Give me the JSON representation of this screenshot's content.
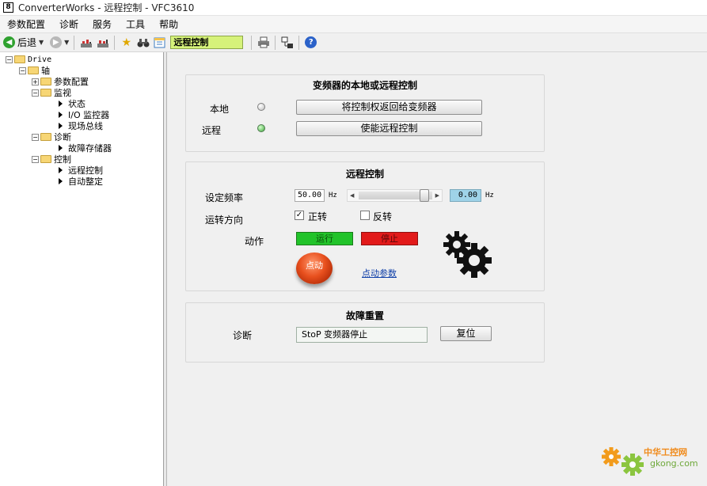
{
  "window": {
    "title": "ConverterWorks - 远程控制 - VFC3610",
    "app_icon": "8"
  },
  "menu": [
    "参数配置",
    "诊断",
    "服务",
    "工具",
    "帮助"
  ],
  "toolbar": {
    "back_label": "后退",
    "current_view": "远程控制",
    "icons": [
      "back-arrow-icon",
      "forward-arrow-icon",
      "upload-icon",
      "download-icon",
      "favorites-star-icon",
      "binoculars-icon",
      "calendar-icon",
      "print-icon",
      "connection-icon",
      "help-icon"
    ]
  },
  "tree": {
    "root": "Drive",
    "axis": "轴",
    "param_config": "参数配置",
    "monitor": "监视",
    "status": "状态",
    "io_monitor": "I/O 监控器",
    "fieldbus": "现场总线",
    "diagnosis": "诊断",
    "fault_memory": "故障存储器",
    "control": "控制",
    "remote_control": "远程控制",
    "auto_tuning": "自动整定"
  },
  "local_remote": {
    "title": "变频器的本地或远程控制",
    "local_label": "本地",
    "remote_label": "远程",
    "return_button": "将控制权返回给变频器",
    "enable_button": "使能远程控制",
    "local_led": "off",
    "remote_led": "on"
  },
  "remote": {
    "title": "远程控制",
    "freq_label": "设定频率",
    "freq_value": "50.00",
    "freq_unit": "Hz",
    "slider_fraction": 0.95,
    "actual_value": "0.00",
    "actual_unit": "Hz",
    "direction_label": "运转方向",
    "forward_label": "正转",
    "forward_checked": true,
    "reverse_label": "反转",
    "reverse_checked": false,
    "action_label": "动作",
    "run_label": "运行",
    "stop_label": "停止",
    "jog_label": "点动",
    "jog_params_link": "点动参数",
    "colors": {
      "run": "#22c32a",
      "stop": "#e21a1a",
      "readout": "#9fd3e8"
    }
  },
  "fault": {
    "title": "故障重置",
    "diag_label": "诊断",
    "status_text": "StoP 变频器停止",
    "reset_button": "复位"
  },
  "watermark": {
    "site_name": "中华工控网",
    "site_url": "gkong.com"
  }
}
